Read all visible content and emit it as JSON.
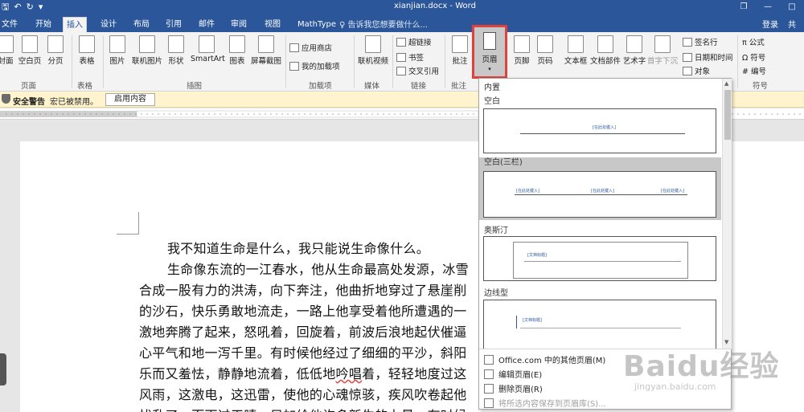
{
  "app": {
    "doc_title": "xianjian.docx - Word"
  },
  "qat": {
    "save": "🖫",
    "undo": "↶",
    "redo": "↻",
    "customize": "▾"
  },
  "window": {
    "restore": "❐",
    "minimize": "—",
    "maximize": "□"
  },
  "tabs": [
    {
      "label": "文件"
    },
    {
      "label": "开始"
    },
    {
      "label": "插入"
    },
    {
      "label": "设计"
    },
    {
      "label": "布局"
    },
    {
      "label": "引用"
    },
    {
      "label": "邮件"
    },
    {
      "label": "审阅"
    },
    {
      "label": "视图"
    },
    {
      "label": "MathType"
    }
  ],
  "tell_me": "♀ 告诉我您想要做什么...",
  "login": "登录",
  "share": "共",
  "ribbon": {
    "buttons": {
      "cover": "封面",
      "blank_page": "空白页",
      "page_break": "分页",
      "table": "表格",
      "picture": "图片",
      "online_picture": "联机图片",
      "shapes": "形状",
      "smartart": "SmartArt",
      "chart": "图表",
      "screenshot": "屏幕截图",
      "store": "应用商店",
      "my_addins": "我的加载项",
      "online_video": "联机视频",
      "hyperlink": "超链接",
      "bookmark": "书签",
      "cross_ref": "交叉引用",
      "comment": "批注",
      "header": "页眉",
      "footer": "页脚",
      "page_number": "页码",
      "textbox": "文本框",
      "doc_parts": "文档部件",
      "wordart": "艺术字",
      "dropcap": "首字下沉",
      "signature": "签名行",
      "datetime": "日期和时间",
      "object": "对象",
      "equation": "π 公式",
      "symbol": "Ω 符号",
      "number": "# 编号"
    },
    "groups": {
      "pages": "页面",
      "tables": "表格",
      "illustrations": "插图",
      "addins": "加载项",
      "media": "媒体",
      "links": "链接",
      "comments": "批注",
      "symbols": "符号"
    }
  },
  "security": {
    "title": "安全警告",
    "message": "宏已被禁用。",
    "enable": "启用内容"
  },
  "document": {
    "lines": [
      "我不知道生命是什么，我只能说生命像什么。",
      "生命像东流的一江春水，他从生命最高处发源，冰雪",
      "合成一股有力的洪涛，向下奔注，他曲折地穿过了悬崖削",
      "的沙石，快乐勇敢地流走，一路上他享受着他所遭遇的一",
      "激地奔腾了起来，怒吼着，回旋着，前波后浪地起伏催逼",
      "心平气和地一泻千里。有时候他经过了细细的平沙，斜阳",
      "乐而又羞怯，静静地流着，低低地吟唱着，轻轻地度过这",
      "风雨，这激电，这迅雷，使他的心魂惊骇，疾风吹卷起他",
      "扰乱了，而雨过天晴，只加给他许多新生的力量，有时候"
    ]
  },
  "gallery": {
    "section": "内置",
    "items": [
      {
        "name": "空白",
        "placeholders": [
          "[在此处键入]"
        ]
      },
      {
        "name": "空白(三栏)",
        "placeholders": [
          "[在此处键入]",
          "[在此处键入]",
          "[在此处键入]"
        ]
      },
      {
        "name": "奥斯汀",
        "placeholders": [
          "[文档标题]"
        ]
      },
      {
        "name": "边线型",
        "placeholders": [
          "[文档标题]"
        ]
      }
    ],
    "menu": [
      {
        "label": "Office.com 中的其他页眉(M)",
        "enabled": true
      },
      {
        "label": "编辑页眉(E)",
        "enabled": true
      },
      {
        "label": "删除页眉(R)",
        "enabled": true
      },
      {
        "label": "将所选内容保存到页眉库(S)...",
        "enabled": false
      }
    ]
  },
  "watermark": {
    "brand": "Baidu经验",
    "url": "jingyan.baidu.com"
  },
  "colors": {
    "accent": "#2b579a",
    "highlight": "#e0413a",
    "warning_bar": "#fff4ce"
  }
}
